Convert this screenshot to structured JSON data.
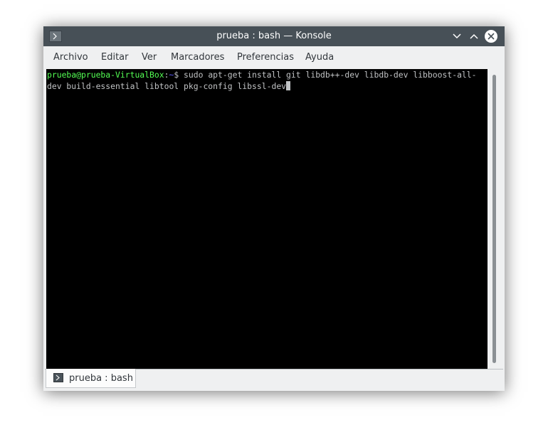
{
  "window": {
    "title": "prueba : bash — Konsole"
  },
  "menu": {
    "items": [
      "Archivo",
      "Editar",
      "Ver",
      "Marcadores",
      "Preferencias",
      "Ayuda"
    ]
  },
  "terminal": {
    "prompt_user": "prueba@prueba-VirtualBox",
    "prompt_sep": ":",
    "prompt_path": "~",
    "prompt_symbol": "$",
    "command_line1": " sudo apt-get install git libdb++-dev libdb-dev libboost-all-",
    "command_line2": "dev build-essential libtool pkg-config libssl-dev"
  },
  "tabs": [
    {
      "label": "prueba : bash",
      "icon": "terminal-icon"
    }
  ],
  "icons": {
    "app": "terminal-icon",
    "minimize": "chevron-down-icon",
    "maximize": "chevron-up-icon",
    "close": "close-icon"
  },
  "colors": {
    "titlebar": "#475057",
    "terminal_bg": "#000000",
    "terminal_fg": "#c0c2c4",
    "prompt_user": "#54ff54",
    "prompt_path": "#5c5cff"
  }
}
